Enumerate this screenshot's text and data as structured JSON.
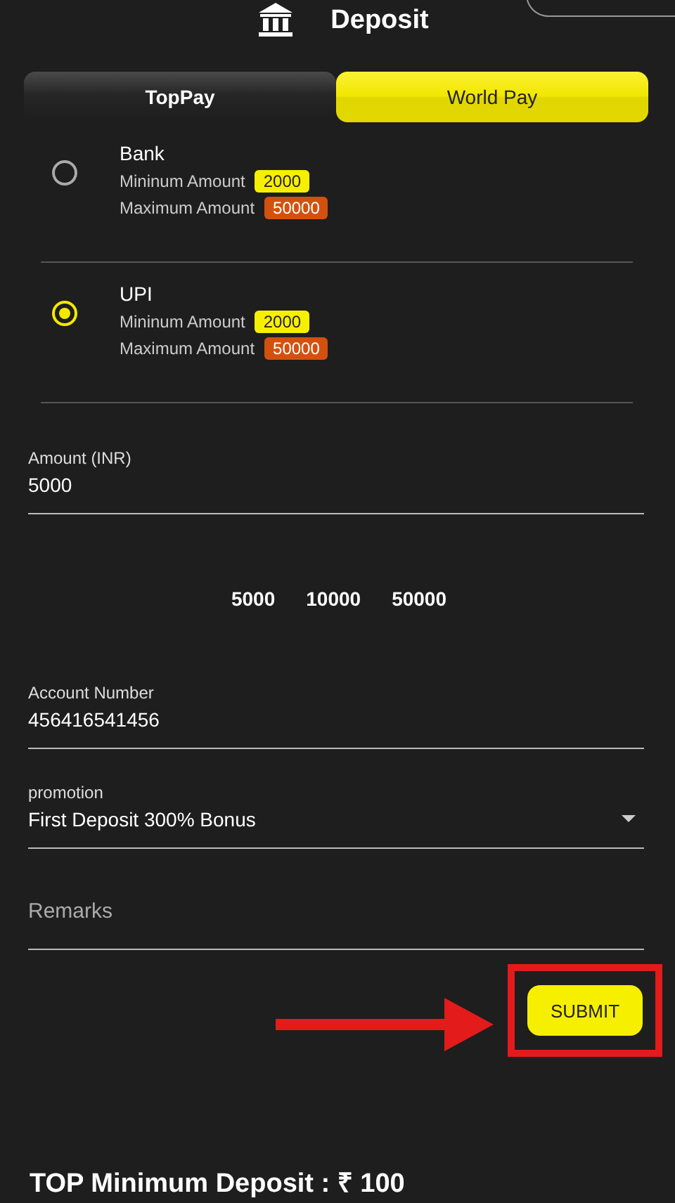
{
  "header": {
    "title": "Deposit"
  },
  "tabs": [
    {
      "label": "TopPay",
      "selected": false
    },
    {
      "label": "World Pay",
      "selected": true
    }
  ],
  "methods": [
    {
      "name": "Bank",
      "selected": false,
      "min_label": "Mininum Amount",
      "min": "2000",
      "max_label": "Maximum Amount",
      "max": "50000"
    },
    {
      "name": "UPI",
      "selected": true,
      "min_label": "Mininum Amount",
      "min": "2000",
      "max_label": "Maximum Amount",
      "max": "50000"
    }
  ],
  "amount": {
    "label": "Amount (INR)",
    "value": "5000"
  },
  "quick_amounts": [
    "5000",
    "10000",
    "50000"
  ],
  "account": {
    "label": "Account Number",
    "value": "456416541456"
  },
  "promotion": {
    "label": "promotion",
    "value": "First Deposit 300% Bonus"
  },
  "remarks": {
    "placeholder": "Remarks"
  },
  "submit": {
    "label": "SUBMIT",
    "highlighted": true
  },
  "footer": {
    "text": "TOP Minimum Deposit : ₹ 100"
  }
}
